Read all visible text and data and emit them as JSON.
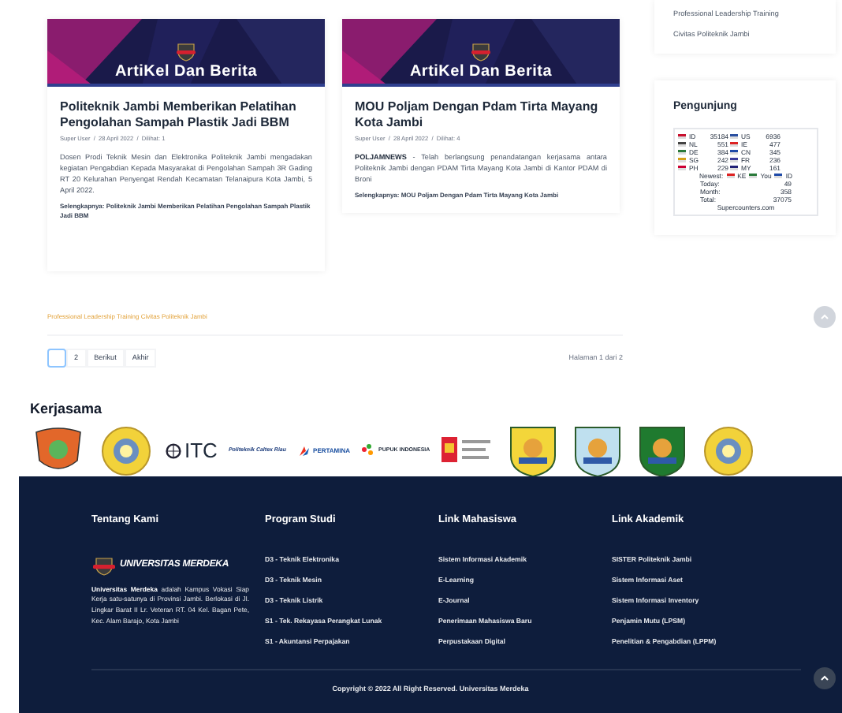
{
  "articles": [
    {
      "banner": "ArtiKel Dan Berita",
      "title": "Politeknik Jambi Memberikan Pelatihan Pengolahan Sampah Plastik Jadi BBM",
      "meta": "Super User  /  28 April 2022  /  Dilihat: 1",
      "body": "Dosen Prodi Teknik Mesin dan Elektronika Politeknik Jambi mengadakan kegiatan Pengabdian Kepada Masyarakat di Pengolahan Sampah 3R Gading RT 20 Kelurahan Penyengat Rendah Kecamatan Telanaipura Kota Jambi, 5 April 2022.",
      "more": "Selengkapnya: Politeknik Jambi Memberikan Pelatihan Pengolahan Sampah Plastik Jadi BBM"
    },
    {
      "banner": "ArtiKel Dan Berita",
      "title": "MOU Poljam Dengan Pdam Tirta Mayang Kota Jambi",
      "meta": "Super User  /  28 April 2022  /  Dilihat: 4",
      "lead": "POLJAMNEWS",
      "body": " - Telah berlangsung penandatangan kerjasama antara Politeknik Jambi dengan PDAM Tirta Mayang Kota Jambi di Kantor PDAM di Broni",
      "more": "Selengkapnya: MOU Poljam Dengan Pdam Tirta Mayang Kota Jambi"
    }
  ],
  "related_link": "Professional Leadership Training Civitas Politeknik Jambi",
  "pagination": {
    "pages": [
      {
        "selected": true
      },
      {
        "label": "2",
        "selected": false
      },
      {
        "label": "Berikut",
        "selected": false
      },
      {
        "label": "Akhir",
        "selected": false
      }
    ],
    "summary": "Halaman 1 dari 2"
  },
  "sidebar": {
    "links": [
      "Professional Leadership Training",
      "Civitas Politeknik Jambi"
    ],
    "visitors": {
      "title": "Pengunjung",
      "rows": [
        [
          "ID",
          "35184",
          "US",
          "6936"
        ],
        [
          "NL",
          "551",
          "IE",
          "477"
        ],
        [
          "DE",
          "384",
          "CN",
          "345"
        ],
        [
          "SG",
          "242",
          "FR",
          "236"
        ],
        [
          "PH",
          "229",
          "MY",
          "161"
        ]
      ],
      "newest": "Newest:",
      "newest_codes": [
        "KE",
        "You",
        "ID"
      ],
      "stats": [
        [
          "Today:",
          "49"
        ],
        [
          "Month:",
          "358"
        ],
        [
          "Total:",
          "37075"
        ]
      ],
      "footer": "Supercounters.com"
    }
  },
  "partners": {
    "title": "Kerjasama",
    "logos": [
      {
        "kind": "crest",
        "color": "#e2672a"
      },
      {
        "kind": "seal",
        "color": "#f2d23a"
      },
      {
        "kind": "wordmark",
        "label": "ITC"
      },
      {
        "kind": "script",
        "label": "Politeknik Caltex Riau"
      },
      {
        "kind": "wordmark2",
        "label": "PERTAMINA"
      },
      {
        "kind": "dots",
        "label": "PUPUK INDONESIA"
      },
      {
        "kind": "flagtext"
      },
      {
        "kind": "shield",
        "color": "#f3d63a"
      },
      {
        "kind": "shield",
        "color": "#bfe0ef"
      },
      {
        "kind": "shield",
        "color": "#1f7a2f"
      },
      {
        "kind": "seal",
        "color": "#f2d23a"
      }
    ]
  },
  "footer": {
    "columns": [
      {
        "title": "Tentang Kami",
        "logo_text": "UNIVERSITAS MERDEKA",
        "about_bold": "Universitas Merdeka",
        "about": " adalah Kampus Vokasi Siap Kerja satu-satunya di Provinsi Jambi. Berlokasi di Jl. Lingkar Barat II Lr. Veteran RT. 04 Kel. Bagan Pete, Kec. Alam Barajo, Kota Jambi"
      },
      {
        "title": "Program Studi",
        "links": [
          "D3 - Teknik Elektronika",
          "D3 - Teknik Mesin",
          "D3 - Teknik Listrik",
          "S1 - Tek. Rekayasa Perangkat Lunak",
          "S1 - Akuntansi Perpajakan"
        ]
      },
      {
        "title": "Link Mahasiswa",
        "links": [
          "Sistem Informasi Akademik",
          "E-Learning",
          "E-Journal",
          "Penerimaan Mahasiswa Baru",
          "Perpustakaan Digital"
        ]
      },
      {
        "title": "Link Akademik",
        "links": [
          "SISTER Politeknik Jambi",
          "Sistem Informasi Aset",
          "Sistem Informasi Inventory",
          "Penjamin Mutu (LPSM)",
          "Penelitian & Pengabdian (LPPM)"
        ]
      }
    ],
    "copyright": "Copyright © 2022 All Right Reserved. Universitas Merdeka"
  }
}
